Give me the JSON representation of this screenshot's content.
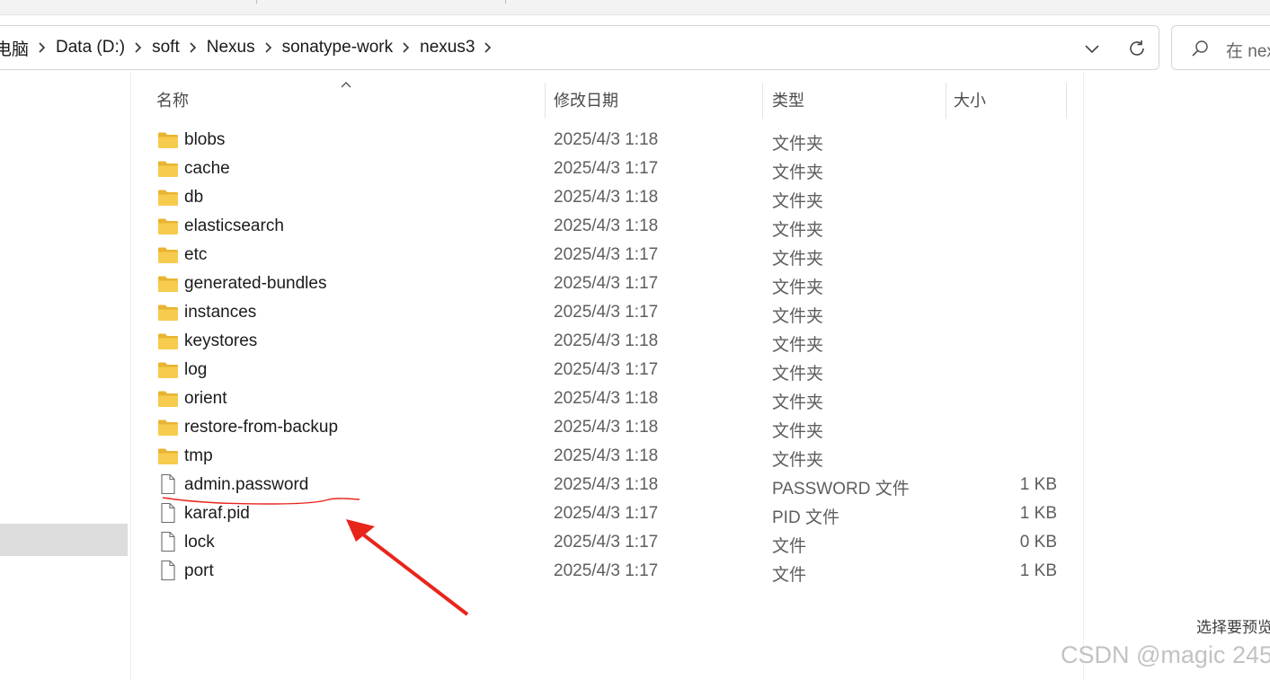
{
  "breadcrumb": {
    "items": [
      "电脑",
      "Data (D:)",
      "soft",
      "Nexus",
      "sonatype-work",
      "nexus3"
    ]
  },
  "search": {
    "placeholder": "在 nex"
  },
  "columns": {
    "name": "名称",
    "date": "修改日期",
    "type": "类型",
    "size": "大小"
  },
  "files": [
    {
      "name": "blobs",
      "date": "2025/4/3 1:18",
      "type": "文件夹",
      "size": "",
      "icon": "folder-icon"
    },
    {
      "name": "cache",
      "date": "2025/4/3 1:17",
      "type": "文件夹",
      "size": "",
      "icon": "folder-icon"
    },
    {
      "name": "db",
      "date": "2025/4/3 1:18",
      "type": "文件夹",
      "size": "",
      "icon": "folder-icon"
    },
    {
      "name": "elasticsearch",
      "date": "2025/4/3 1:18",
      "type": "文件夹",
      "size": "",
      "icon": "folder-icon"
    },
    {
      "name": "etc",
      "date": "2025/4/3 1:17",
      "type": "文件夹",
      "size": "",
      "icon": "folder-icon"
    },
    {
      "name": "generated-bundles",
      "date": "2025/4/3 1:17",
      "type": "文件夹",
      "size": "",
      "icon": "folder-icon"
    },
    {
      "name": "instances",
      "date": "2025/4/3 1:17",
      "type": "文件夹",
      "size": "",
      "icon": "folder-icon"
    },
    {
      "name": "keystores",
      "date": "2025/4/3 1:18",
      "type": "文件夹",
      "size": "",
      "icon": "folder-icon"
    },
    {
      "name": "log",
      "date": "2025/4/3 1:17",
      "type": "文件夹",
      "size": "",
      "icon": "folder-icon"
    },
    {
      "name": "orient",
      "date": "2025/4/3 1:18",
      "type": "文件夹",
      "size": "",
      "icon": "folder-icon"
    },
    {
      "name": "restore-from-backup",
      "date": "2025/4/3 1:18",
      "type": "文件夹",
      "size": "",
      "icon": "folder-icon"
    },
    {
      "name": "tmp",
      "date": "2025/4/3 1:18",
      "type": "文件夹",
      "size": "",
      "icon": "folder-icon"
    },
    {
      "name": "admin.password",
      "date": "2025/4/3 1:18",
      "type": "PASSWORD 文件",
      "size": "1 KB",
      "icon": "file-icon"
    },
    {
      "name": "karaf.pid",
      "date": "2025/4/3 1:17",
      "type": "PID 文件",
      "size": "1 KB",
      "icon": "file-icon"
    },
    {
      "name": "lock",
      "date": "2025/4/3 1:17",
      "type": "文件",
      "size": "0 KB",
      "icon": "file-icon"
    },
    {
      "name": "port",
      "date": "2025/4/3 1:17",
      "type": "文件",
      "size": "1 KB",
      "icon": "file-icon"
    }
  ],
  "preview_hint": "选择要预览",
  "watermark": "CSDN @magic 245",
  "colors": {
    "folder": "#f4c542",
    "annotation": "#e8251b",
    "nav_selected": "#dcdcdc"
  }
}
